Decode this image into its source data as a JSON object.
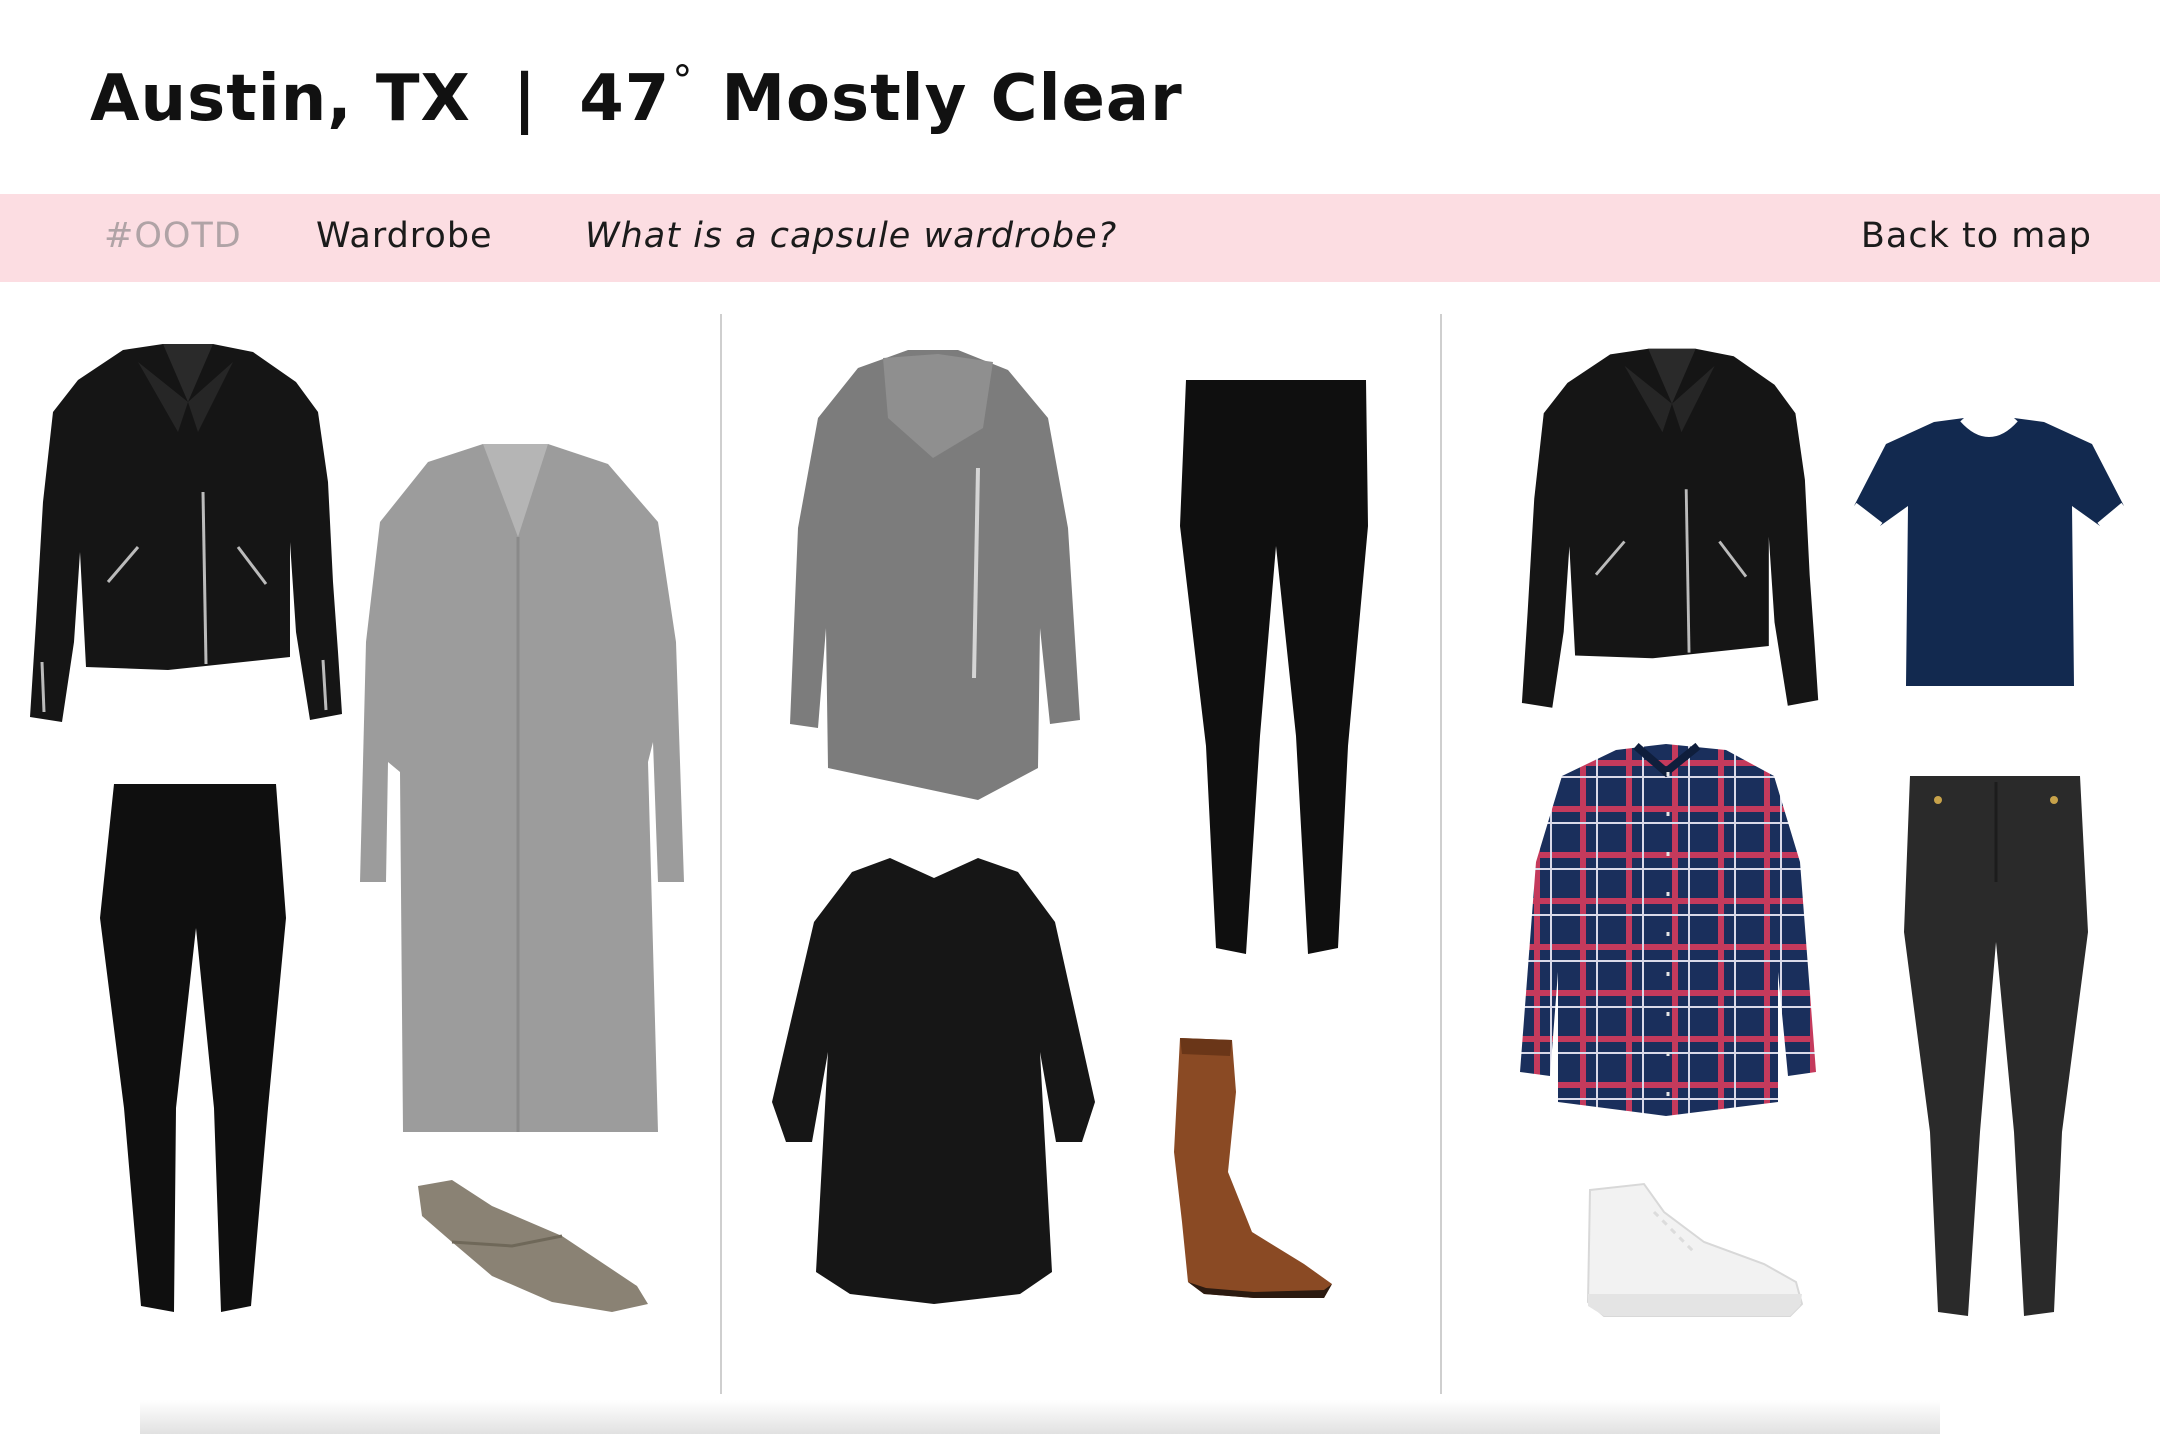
{
  "header": {
    "location": "Austin, TX",
    "separator": "|",
    "temperature": "47",
    "degree": "°",
    "condition": "Mostly Clear"
  },
  "nav": {
    "ootd": "#OOTD",
    "wardrobe": "Wardrobe",
    "capsule": "What is a capsule wardrobe?",
    "back": "Back to map"
  },
  "outfits": [
    {
      "items": [
        "black leather jacket",
        "gray knit long cardigan",
        "black leggings",
        "taupe pointed flats"
      ]
    },
    {
      "items": [
        "gray boucle cardigan",
        "black leggings",
        "black shift dress",
        "brown leather riding boot"
      ]
    },
    {
      "items": [
        "black leather jacket",
        "navy ringer t-shirt",
        "navy plaid flannel shirt",
        "black skinny jeans",
        "white high-top sneakers"
      ]
    }
  ],
  "colors": {
    "nav_bg": "#fcdde2",
    "ootd_text": "#b0a3a6",
    "divider": "#cfcfcf"
  }
}
